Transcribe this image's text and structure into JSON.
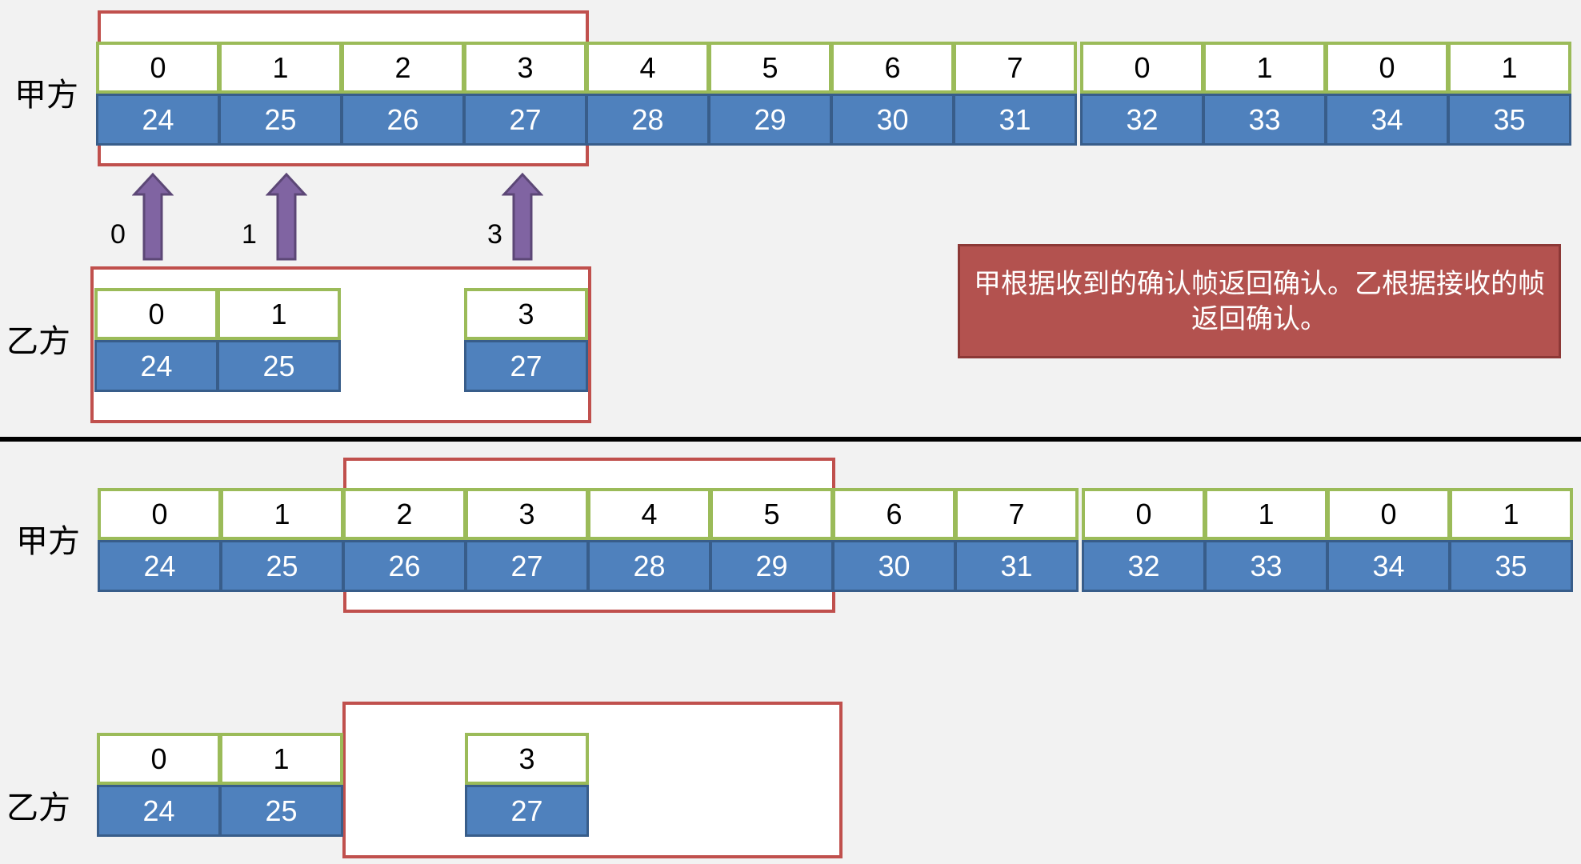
{
  "colors": {
    "window_border": "#c0504d",
    "seq_border": "#9bbb59",
    "frame_fill": "#4f81bd",
    "arrow": "#8064a2",
    "note_fill": "#b3524f"
  },
  "top": {
    "sender_label": "甲方",
    "receiver_label": "乙方",
    "sender_seq": [
      "0",
      "1",
      "2",
      "3",
      "4",
      "5",
      "6",
      "7",
      "0",
      "1",
      "0",
      "1"
    ],
    "sender_frames": [
      "24",
      "25",
      "26",
      "27",
      "28",
      "29",
      "30",
      "31",
      "32",
      "33",
      "34",
      "35"
    ],
    "receiver_seq": [
      "0",
      "1",
      "3"
    ],
    "receiver_frames": [
      "24",
      "25",
      "27"
    ],
    "acks": [
      "0",
      "1",
      "3"
    ],
    "note": "甲根据收到的确认帧返回确认。乙根据接收的帧返回确认。"
  },
  "bottom": {
    "sender_label": "甲方",
    "receiver_label": "乙方",
    "sender_seq": [
      "0",
      "1",
      "2",
      "3",
      "4",
      "5",
      "6",
      "7",
      "0",
      "1",
      "0",
      "1"
    ],
    "sender_frames": [
      "24",
      "25",
      "26",
      "27",
      "28",
      "29",
      "30",
      "31",
      "32",
      "33",
      "34",
      "35"
    ],
    "receiver_seq": [
      "0",
      "1",
      "3"
    ],
    "receiver_frames": [
      "24",
      "25",
      "27"
    ]
  }
}
